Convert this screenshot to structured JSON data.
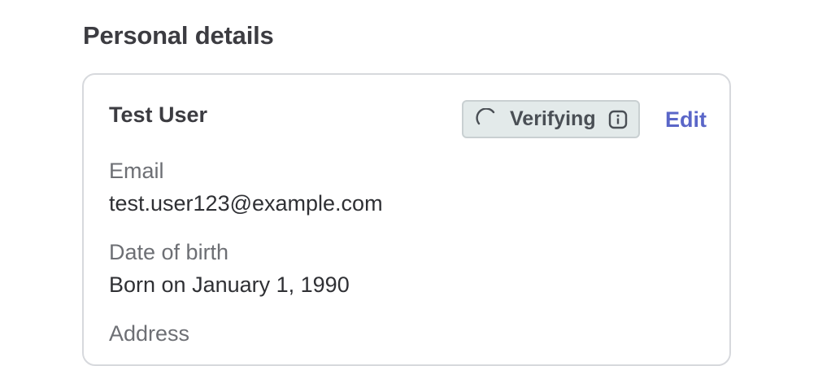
{
  "section": {
    "title": "Personal details"
  },
  "card": {
    "name": "Test User",
    "status": {
      "label": "Verifying",
      "icon": "spinner-icon",
      "info_icon": "info-icon",
      "background": "#e3eaea",
      "border": "#c9d0d2"
    },
    "edit_label": "Edit",
    "accent_color": "#5a66c8",
    "fields": [
      {
        "label": "Email",
        "value": "test.user123@example.com"
      },
      {
        "label": "Date of birth",
        "value": "Born on January 1, 1990"
      },
      {
        "label": "Address",
        "value": ""
      }
    ]
  }
}
